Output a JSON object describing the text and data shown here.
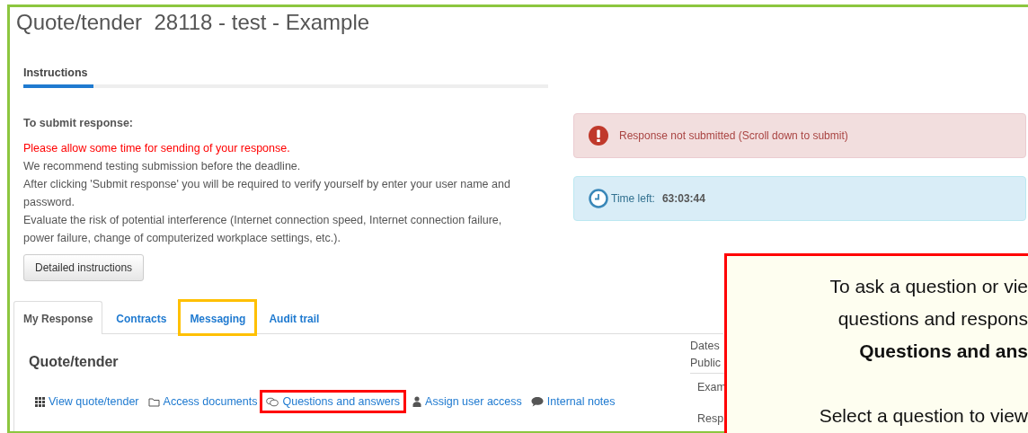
{
  "page_title": "Quote/tender  28118 - test - Example",
  "section_tab": {
    "label": "Instructions",
    "selected": true
  },
  "instructions": {
    "heading": "To submit response:",
    "lines": [
      {
        "text": "Please allow some time for sending of your response.",
        "kind": "warning"
      },
      {
        "text": "We recommend testing submission before the deadline.",
        "kind": "plain"
      },
      {
        "text": "After clicking 'Submit response' you will be required to verify yourself by enter your user name and password.",
        "kind": "plain"
      },
      {
        "text": "Evaluate the risk of potential interference (Internet connection speed, Internet connection failure, power failure, change of computerized workplace settings, etc.).",
        "kind": "plain"
      }
    ],
    "button": "Detailed instructions"
  },
  "alerts": [
    {
      "kind": "danger",
      "text": "Response not submitted (Scroll down to submit)"
    },
    {
      "kind": "info",
      "label": "Time left:",
      "value": "63:03:44"
    }
  ],
  "tabs": [
    {
      "label": "My Response",
      "selected": true,
      "highlighted": false
    },
    {
      "label": "Contracts",
      "selected": false,
      "highlighted": false
    },
    {
      "label": "Messaging",
      "selected": false,
      "highlighted": true
    },
    {
      "label": "Audit trail",
      "selected": false,
      "highlighted": false
    }
  ],
  "panel": {
    "heading": "Quote/tender",
    "links": [
      {
        "label": "View quote/tender",
        "highlighted": false
      },
      {
        "label": "Access documents",
        "highlighted": false
      },
      {
        "label": "Questions and answers",
        "highlighted": true
      },
      {
        "label": "Assign user access",
        "highlighted": false
      },
      {
        "label": "Internal notes",
        "highlighted": false
      }
    ],
    "details": [
      {
        "text": "Dates",
        "kind": "header"
      },
      {
        "text": "Public",
        "kind": "header"
      },
      {
        "text": "Exam",
        "kind": "value"
      },
      {
        "text": "Resp",
        "kind": "value"
      }
    ]
  },
  "callout": {
    "paragraphs": [
      {
        "lines": [
          {
            "text": "To ask a question or vie",
            "bold": false
          },
          {
            "text": "questions and respons",
            "bold": false
          },
          {
            "text": "Questions and ans",
            "bold": true
          }
        ]
      },
      {
        "lines": [
          {
            "text": "Select a question to view",
            "bold": false
          }
        ]
      }
    ]
  }
}
